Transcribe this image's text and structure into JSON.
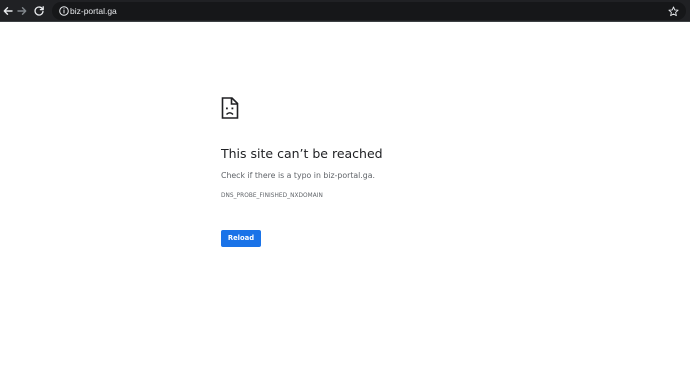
{
  "browser": {
    "url": "biz-portal.ga",
    "back_icon": "arrow-left-icon",
    "forward_icon": "arrow-right-icon",
    "reload_icon": "reload-icon",
    "info_icon": "info-icon",
    "bookmark_icon": "star-icon"
  },
  "error_page": {
    "icon": "sad-document-icon",
    "title": "This site can’t be reached",
    "description": "Check if there is a typo in biz-portal.ga.",
    "error_code": "DNS_PROBE_FINISHED_NXDOMAIN",
    "reload_label": "Reload"
  },
  "colors": {
    "toolbar_bg": "#202124",
    "accent": "#1a73e8",
    "text_primary": "#202124",
    "text_secondary": "#5f6368"
  }
}
